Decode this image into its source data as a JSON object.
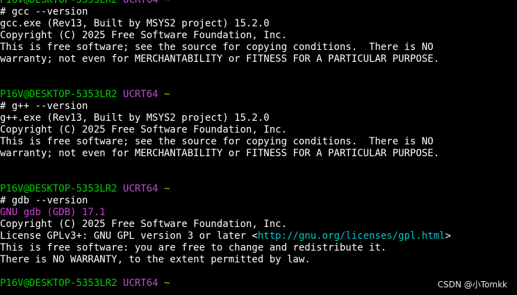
{
  "colors": {
    "prompt_user": "#00d000",
    "prompt_env": "#c050d0",
    "prompt_tilde": "#d4c000",
    "gdb_version": "#d040d0",
    "url": "#00c8c8",
    "background": "#000000",
    "text": "#ffffff"
  },
  "prompt": {
    "user_host": "P16V@DESKTOP-5353LR2",
    "env": "UCRT64",
    "path": "~",
    "symbol": "#"
  },
  "blocks": [
    {
      "command": "gcc --version",
      "output": [
        "gcc.exe (Rev13, Built by MSYS2 project) 15.2.0",
        "Copyright (C) 2025 Free Software Foundation, Inc.",
        "This is free software; see the source for copying conditions.  There is NO",
        "warranty; not even for MERCHANTABILITY or FITNESS FOR A PARTICULAR PURPOSE."
      ]
    },
    {
      "command": "g++ --version",
      "output": [
        "g++.exe (Rev13, Built by MSYS2 project) 15.2.0",
        "Copyright (C) 2025 Free Software Foundation, Inc.",
        "This is free software; see the source for copying conditions.  There is NO",
        "warranty; not even for MERCHANTABILITY or FITNESS FOR A PARTICULAR PURPOSE."
      ]
    },
    {
      "command": "gdb --version",
      "gdb_version_line": "GNU gdb (GDB) 17.1",
      "output": [
        "Copyright (C) 2025 Free Software Foundation, Inc."
      ],
      "license_prefix": "License GPLv3+: GNU GPL version 3 or later <",
      "license_url": "http://gnu.org/licenses/gpl.html",
      "license_suffix": ">",
      "output_after": [
        "This is free software: you are free to change and redistribute it.",
        "There is NO WARRANTY, to the extent permitted by law."
      ]
    }
  ],
  "watermark": "CSDN @小Tomkk"
}
